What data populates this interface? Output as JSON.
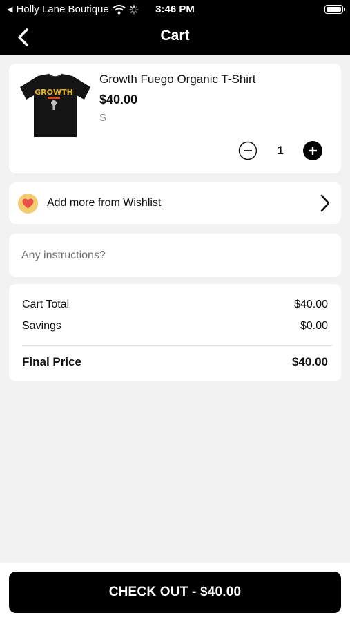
{
  "status_bar": {
    "back_app": "Holly Lane Boutique",
    "time": "3:46 PM"
  },
  "nav": {
    "title": "Cart",
    "back_icon": "chevron-left-icon"
  },
  "cart": {
    "items": [
      {
        "name": "Growth Fuego Organic T-Shirt",
        "price": "$40.00",
        "size": "S",
        "quantity": "1",
        "image_text": "GROWTH"
      }
    ]
  },
  "wishlist": {
    "label": "Add more from Wishlist",
    "icon": "heart-icon"
  },
  "instructions": {
    "placeholder": "Any instructions?"
  },
  "summary": {
    "cart_total_label": "Cart Total",
    "cart_total_value": "$40.00",
    "savings_label": "Savings",
    "savings_value": "$0.00",
    "final_label": "Final Price",
    "final_value": "$40.00"
  },
  "checkout": {
    "label": "CHECK OUT - $40.00"
  },
  "colors": {
    "bar": "#000000",
    "background": "#f2f2f2",
    "heart_badge": "#f2cc6e",
    "heart": "#e8524a"
  }
}
